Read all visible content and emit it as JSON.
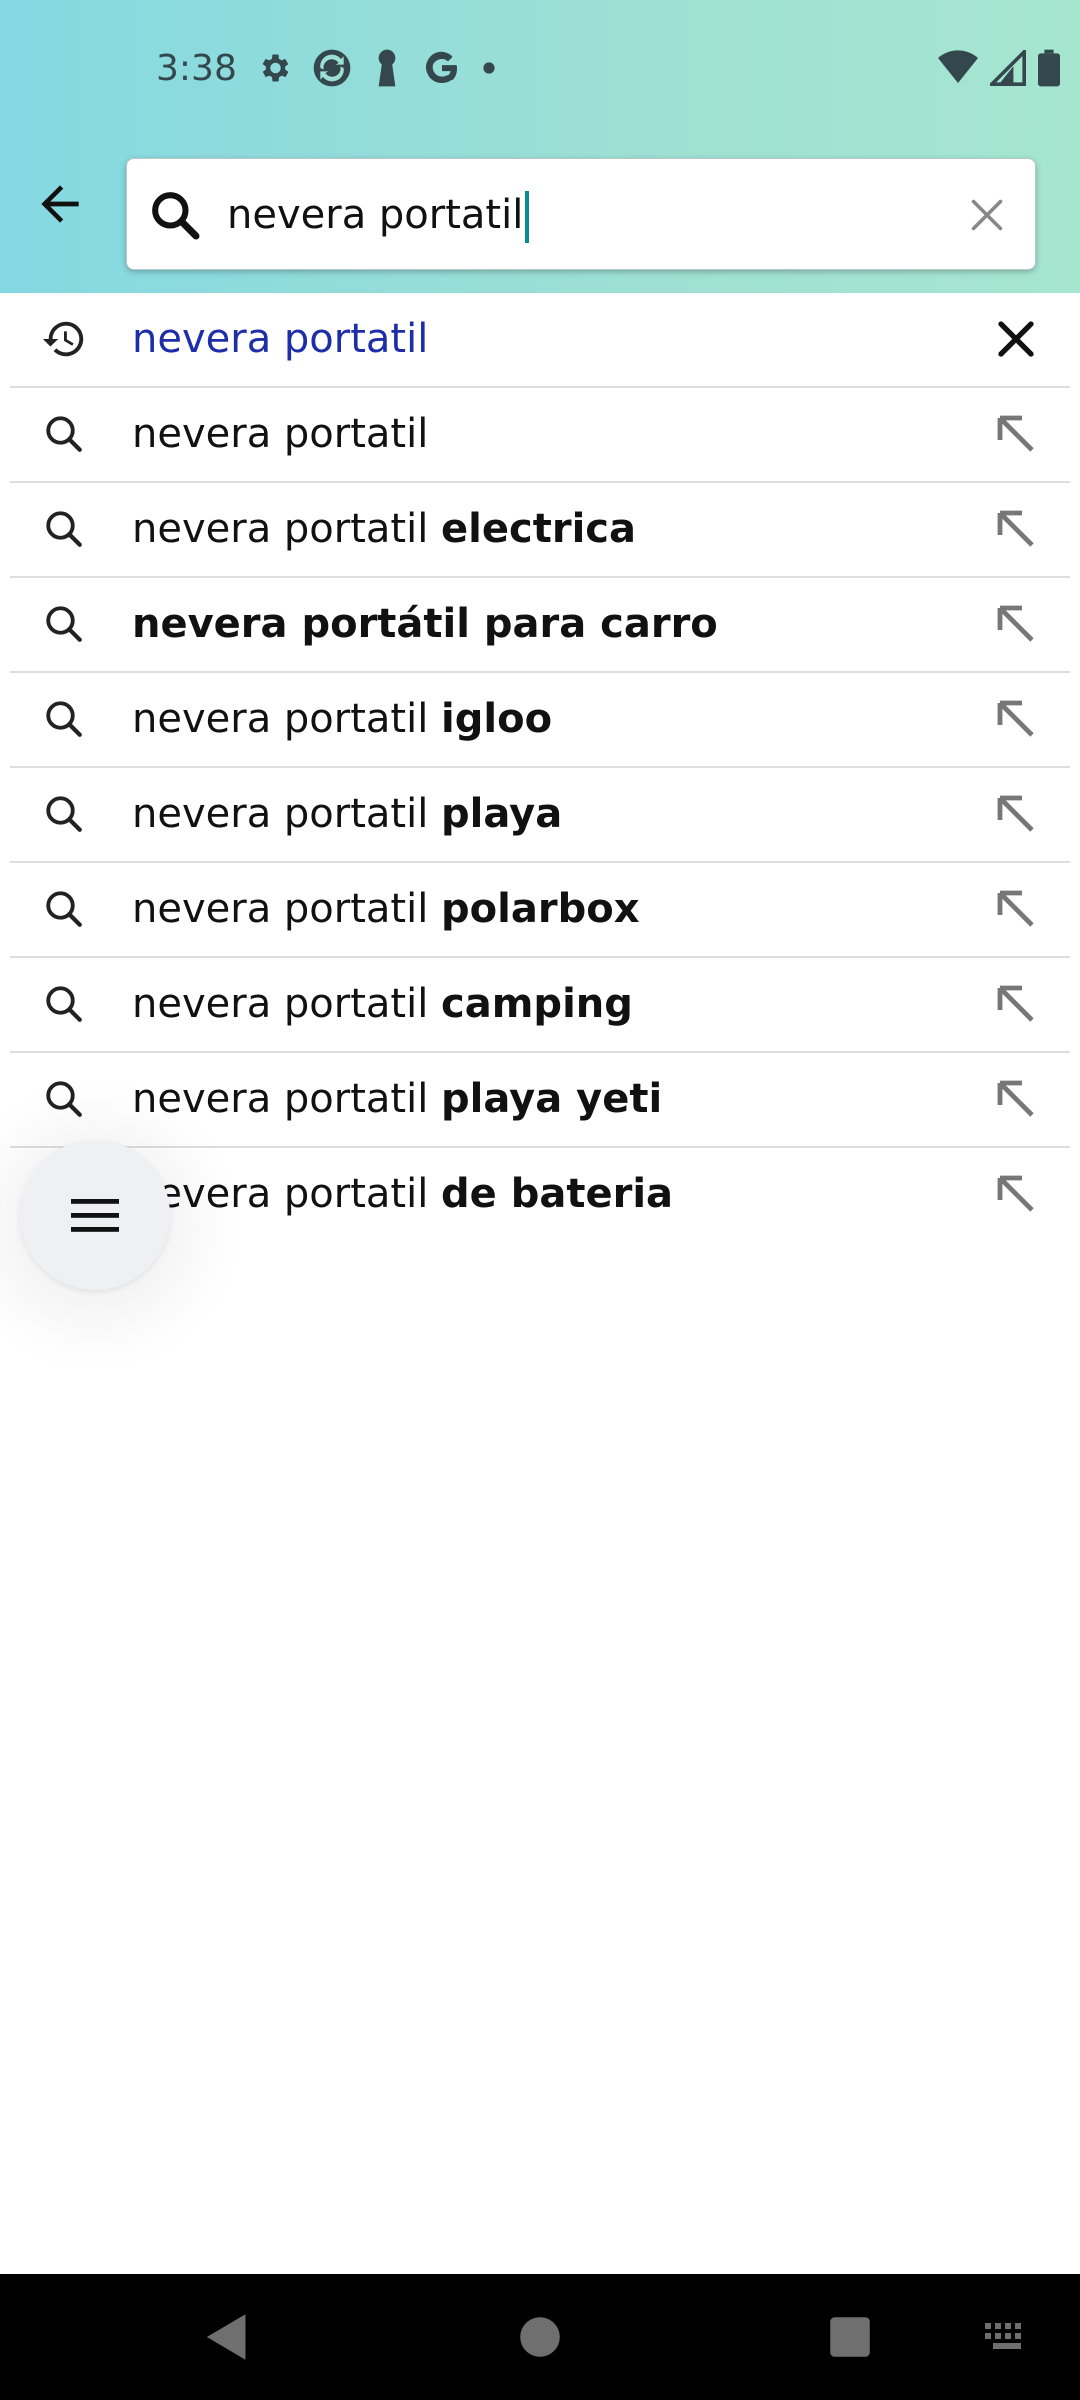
{
  "status_bar": {
    "time": "3:38",
    "left_icons": [
      "gear-icon",
      "sync-icon",
      "keyhole-icon",
      "google-icon",
      "dot-icon"
    ],
    "right_icons": [
      "wifi-icon",
      "signal-icon",
      "battery-icon"
    ]
  },
  "search": {
    "query": "nevera portatil",
    "back_icon": "arrow-left-icon",
    "search_icon": "search-icon",
    "clear_icon": "close-icon"
  },
  "suggestions": [
    {
      "type": "history",
      "icon": "history-icon",
      "prefix": "nevera portatil",
      "bold": "",
      "action_icon": "remove-icon"
    },
    {
      "type": "suggestion",
      "icon": "search-icon",
      "prefix": "nevera portatil",
      "bold": "",
      "action_icon": "arrow-up-left-icon"
    },
    {
      "type": "suggestion",
      "icon": "search-icon",
      "prefix": "nevera portatil ",
      "bold": "electrica",
      "action_icon": "arrow-up-left-icon"
    },
    {
      "type": "suggestion",
      "icon": "search-icon",
      "prefix": "",
      "bold": "nevera portátil para carro",
      "action_icon": "arrow-up-left-icon"
    },
    {
      "type": "suggestion",
      "icon": "search-icon",
      "prefix": "nevera portatil ",
      "bold": "igloo",
      "action_icon": "arrow-up-left-icon"
    },
    {
      "type": "suggestion",
      "icon": "search-icon",
      "prefix": "nevera portatil ",
      "bold": "playa",
      "action_icon": "arrow-up-left-icon"
    },
    {
      "type": "suggestion",
      "icon": "search-icon",
      "prefix": "nevera portatil ",
      "bold": "polarbox",
      "action_icon": "arrow-up-left-icon"
    },
    {
      "type": "suggestion",
      "icon": "search-icon",
      "prefix": "nevera portatil ",
      "bold": "camping",
      "action_icon": "arrow-up-left-icon"
    },
    {
      "type": "suggestion",
      "icon": "search-icon",
      "prefix": "nevera portatil ",
      "bold": "playa yeti",
      "action_icon": "arrow-up-left-icon"
    },
    {
      "type": "suggestion",
      "icon": "search-icon",
      "prefix": "nevera portatil ",
      "bold": "de bateria",
      "action_icon": "arrow-up-left-icon"
    }
  ],
  "fab": {
    "icon": "menu-icon"
  },
  "nav_bar": {
    "icons": [
      "back-triangle-icon",
      "home-circle-icon",
      "recents-square-icon",
      "keyboard-icon"
    ]
  },
  "colors": {
    "header_start": "#84d8e2",
    "header_end": "#a6e6d0",
    "history_text": "#1d2ea8",
    "caret": "#0f8a8a"
  }
}
